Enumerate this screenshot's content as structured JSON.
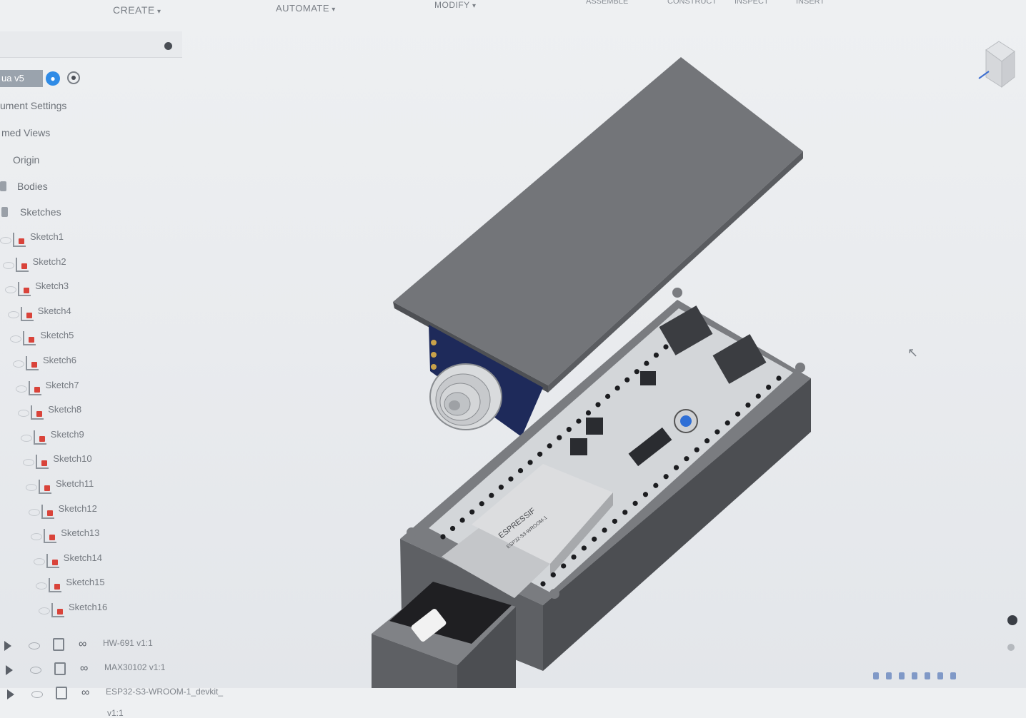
{
  "toolbar": {
    "create": "CREATE",
    "automate": "AUTOMATE",
    "modify": "MODIFY",
    "assemble": "ASSEMBLE",
    "construct": "CONSTRUCT",
    "inspect": "INSPECT",
    "insert": "INSERT"
  },
  "browser": {
    "root_label": "ua v5",
    "items": {
      "document_settings": "ument Settings",
      "named_views": "med Views",
      "origin": "Origin",
      "bodies": "Bodies",
      "sketches": "Sketches"
    },
    "sketches": [
      "Sketch1",
      "Sketch2",
      "Sketch3",
      "Sketch4",
      "Sketch5",
      "Sketch6",
      "Sketch7",
      "Sketch8",
      "Sketch9",
      "Sketch10",
      "Sketch11",
      "Sketch12",
      "Sketch13",
      "Sketch14",
      "Sketch15",
      "Sketch16"
    ],
    "components": [
      "HW-691 v1:1",
      "MAX30102 v1:1",
      "ESP32-S3-WROOM-1_devkit_",
      "v1:1"
    ]
  },
  "model": {
    "module_label_1": "ESPRESSIF",
    "module_label_2": "ESP32-S3-WROOM-1"
  },
  "colors": {
    "accent_blue": "#2f8be6",
    "sketch_red": "#d9433a",
    "enclosure_gray": "#6e7073"
  }
}
